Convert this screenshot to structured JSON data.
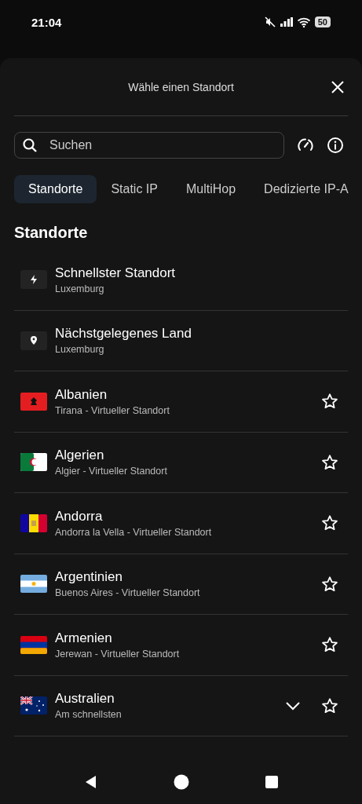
{
  "status_bar": {
    "time": "21:04",
    "battery": "50"
  },
  "sheet": {
    "title": "Wähle einen Standort"
  },
  "search": {
    "placeholder": "Suchen"
  },
  "tabs": [
    {
      "label": "Standorte",
      "selected": true
    },
    {
      "label": "Static IP",
      "selected": false
    },
    {
      "label": "MultiHop",
      "selected": false
    },
    {
      "label": "Dedizierte IP-A",
      "selected": false
    }
  ],
  "section_title": "Standorte",
  "locations": [
    {
      "kind": "fastest",
      "name": "Schnellster Standort",
      "detail": "Luxemburg"
    },
    {
      "kind": "nearest",
      "name": "Nächstgelegenes Land",
      "detail": "Luxemburg"
    },
    {
      "kind": "albania",
      "name": "Albanien",
      "detail": "Tirana - Virtueller Standort",
      "favorite": false,
      "expandable": false
    },
    {
      "kind": "algeria",
      "name": "Algerien",
      "detail": "Algier - Virtueller Standort",
      "favorite": false,
      "expandable": false
    },
    {
      "kind": "andorra",
      "name": "Andorra",
      "detail": "Andorra la Vella - Virtueller Standort",
      "favorite": false,
      "expandable": false
    },
    {
      "kind": "argentina",
      "name": "Argentinien",
      "detail": "Buenos Aires - Virtueller Standort",
      "favorite": false,
      "expandable": false
    },
    {
      "kind": "armenia",
      "name": "Armenien",
      "detail": "Jerewan - Virtueller Standort",
      "favorite": false,
      "expandable": false
    },
    {
      "kind": "australia",
      "name": "Australien",
      "detail": "Am schnellsten",
      "favorite": false,
      "expandable": true
    }
  ]
}
